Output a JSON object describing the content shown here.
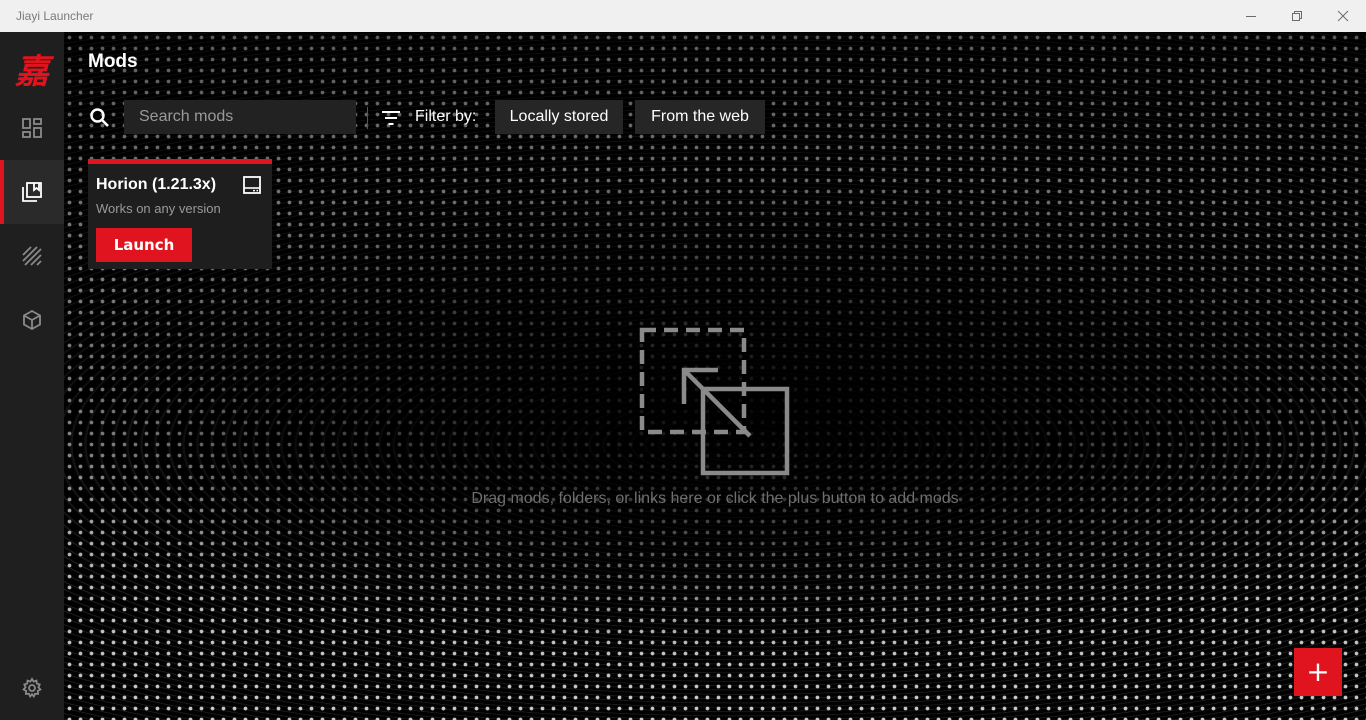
{
  "window": {
    "title": "Jiayi Launcher",
    "controls": {
      "minimize_icon": "minimize-icon",
      "maximize_icon": "restore-icon",
      "close_icon": "close-icon"
    }
  },
  "brand": {
    "logo_text": "嘉",
    "accent_color": "#e0141e"
  },
  "sidebar": {
    "items": [
      {
        "id": "dashboard",
        "icon": "dashboard-icon",
        "active": false
      },
      {
        "id": "mods",
        "icon": "mods-library-icon",
        "active": true
      },
      {
        "id": "versions",
        "icon": "stripes-icon",
        "active": false
      },
      {
        "id": "packages",
        "icon": "cube-icon",
        "active": false
      }
    ],
    "settings_icon": "gear-icon"
  },
  "page": {
    "title": "Mods"
  },
  "toolbar": {
    "search": {
      "placeholder": "Search mods",
      "value": "",
      "icon": "search-icon"
    },
    "filter": {
      "icon": "filter-icon",
      "label": "Filter by:",
      "options": [
        "Locally stored",
        "From the web"
      ]
    }
  },
  "mods": [
    {
      "name": "Horion (1.21.3x)",
      "compatibility": "Works on any version",
      "type_icon": "local-storage-icon",
      "launch_label": "Launch"
    }
  ],
  "drop_zone": {
    "icon": "drag-drop-icon",
    "hint": "Drag mods, folders, or links here or click the plus button to add mods"
  },
  "fab": {
    "label": "+",
    "icon": "plus-icon"
  }
}
